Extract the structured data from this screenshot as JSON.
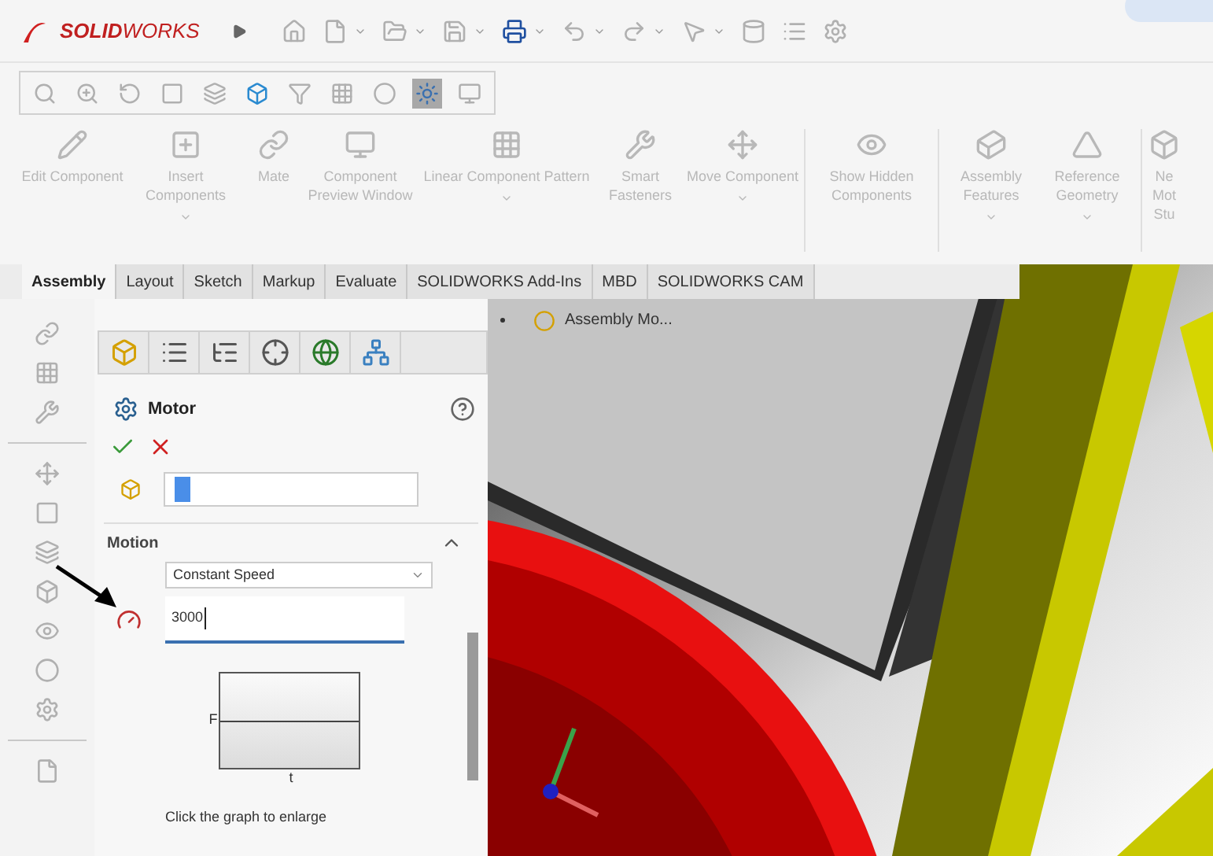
{
  "logo": "**SOLID**WORKS",
  "view_toolbar": [
    {
      "selected": false
    },
    {
      "selected": false
    },
    {
      "selected": false
    },
    {
      "selected": false
    },
    {
      "selected": false
    },
    {
      "selected": false
    },
    {
      "selected": false
    },
    {
      "selected": false
    },
    {
      "selected": false
    },
    {
      "selected": true
    },
    {
      "selected": false
    }
  ],
  "ribbon": [
    {
      "label": "Edit Component",
      "disabled": true,
      "dropdown": false
    },
    {
      "label": "Insert Components",
      "disabled": true,
      "dropdown": true
    },
    {
      "label": "Mate",
      "disabled": true,
      "dropdown": false
    },
    {
      "label": "Component Preview Window",
      "disabled": true,
      "dropdown": false
    },
    {
      "label": "Linear Component Pattern",
      "disabled": true,
      "dropdown": true
    },
    {
      "label": "Smart Fasteners",
      "disabled": true,
      "dropdown": false
    },
    {
      "label": "Move Component",
      "disabled": true,
      "dropdown": true
    },
    {
      "label": "Show Hidden Components",
      "disabled": true,
      "dropdown": false
    },
    {
      "label": "Assembly Features",
      "disabled": true,
      "dropdown": true
    },
    {
      "label": "Reference Geometry",
      "disabled": true,
      "dropdown": true
    },
    {
      "label": "Ne Mot Stu",
      "disabled": true,
      "dropdown": false
    }
  ],
  "tabs": [
    {
      "label": "Assembly",
      "selected": true
    },
    {
      "label": "Layout",
      "selected": false
    },
    {
      "label": "Sketch",
      "selected": false
    },
    {
      "label": "Markup",
      "selected": false
    },
    {
      "label": "Evaluate",
      "selected": false
    },
    {
      "label": "SOLIDWORKS Add-Ins",
      "selected": false
    },
    {
      "label": "MBD",
      "selected": false
    },
    {
      "label": "SOLIDWORKS CAM",
      "selected": false
    }
  ],
  "tree": {
    "label": "Assembly Mo..."
  },
  "property_manager": {
    "title": "Motor",
    "motion": {
      "title": "Motion",
      "expanded": true,
      "motor_type": "Constant Speed",
      "speed": "3000",
      "graph": {
        "y_label": "F",
        "x_label": "t"
      },
      "hint": "Click the graph to enlarge"
    }
  }
}
